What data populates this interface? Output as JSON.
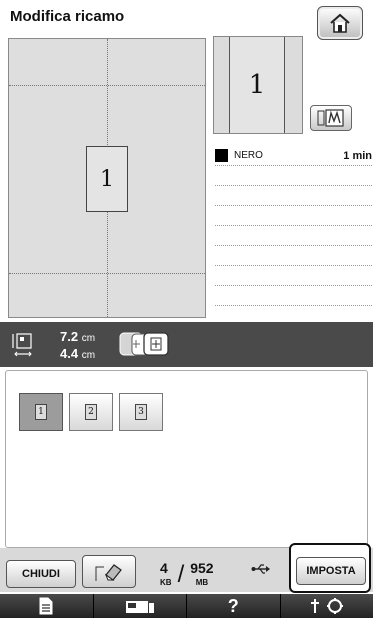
{
  "header": {
    "title": "Modifica ricamo"
  },
  "pattern": {
    "glyph": "1"
  },
  "colors": [
    {
      "name": "NERO",
      "time": "1 min",
      "swatch": "#000000"
    }
  ],
  "size": {
    "width_value": "7.2",
    "height_value": "4.4",
    "unit": "cm"
  },
  "pattern_buttons": [
    {
      "glyph": "1",
      "selected": true
    },
    {
      "glyph": "2",
      "selected": false
    },
    {
      "glyph": "3",
      "selected": false
    }
  ],
  "footer": {
    "close_label": "CHIUDI",
    "set_label": "IMPOSTA",
    "memory": {
      "used": "4",
      "used_unit": "KB",
      "total": "952",
      "total_unit": "MB"
    }
  },
  "tabs": [
    {
      "icon": "page-icon"
    },
    {
      "icon": "machine-icon"
    },
    {
      "label": "?",
      "icon": "help-icon"
    },
    {
      "icon": "settings-icon"
    }
  ]
}
